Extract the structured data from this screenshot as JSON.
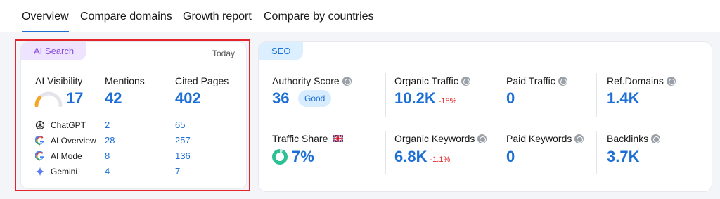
{
  "tabs": [
    {
      "label": "Overview",
      "active": true
    },
    {
      "label": "Compare domains"
    },
    {
      "label": "Growth report"
    },
    {
      "label": "Compare by countries"
    }
  ],
  "ai_search": {
    "badge": "AI Search",
    "period": "Today",
    "columns": {
      "visibility": {
        "label": "AI Visibility",
        "value": "17",
        "gauge_percent": 17
      },
      "mentions": {
        "label": "Mentions",
        "value": "42"
      },
      "cited": {
        "label": "Cited Pages",
        "value": "402"
      }
    },
    "engines": [
      {
        "name": "ChatGPT",
        "icon": "chatgpt-icon",
        "mentions": "2",
        "cited": "65"
      },
      {
        "name": "AI Overview",
        "icon": "google-icon",
        "mentions": "28",
        "cited": "257"
      },
      {
        "name": "AI Mode",
        "icon": "google-icon",
        "mentions": "8",
        "cited": "136"
      },
      {
        "name": "Gemini",
        "icon": "gemini-icon",
        "mentions": "4",
        "cited": "7"
      }
    ]
  },
  "seo": {
    "badge": "SEO",
    "metrics": {
      "authority": {
        "label": "Authority Score",
        "value": "36",
        "badge": "Good"
      },
      "organic_traffic": {
        "label": "Organic Traffic",
        "value": "10.2K",
        "delta": "-18%"
      },
      "paid_traffic": {
        "label": "Paid Traffic",
        "value": "0"
      },
      "ref_domains": {
        "label": "Ref.Domains",
        "value": "1.4K"
      },
      "traffic_share": {
        "label": "Traffic Share",
        "value": "7%",
        "flag": "uk-flag-icon",
        "ring_percent": 7
      },
      "organic_keywords": {
        "label": "Organic Keywords",
        "value": "6.8K",
        "delta": "-1.1%"
      },
      "paid_keywords": {
        "label": "Paid Keywords",
        "value": "0"
      },
      "backlinks": {
        "label": "Backlinks",
        "value": "3.7K"
      }
    }
  },
  "colors": {
    "accent": "#1d6fd6",
    "negative": "#e3262b",
    "ai_badge_bg": "#efe4ff",
    "ai_badge_text": "#8a4fd9",
    "seo_badge_bg": "#dcefff",
    "seo_badge_text": "#1d6fd6",
    "good_badge_bg": "#d7ecff",
    "gauge_orange": "#f5a623",
    "ring_green": "#2fbf94"
  }
}
